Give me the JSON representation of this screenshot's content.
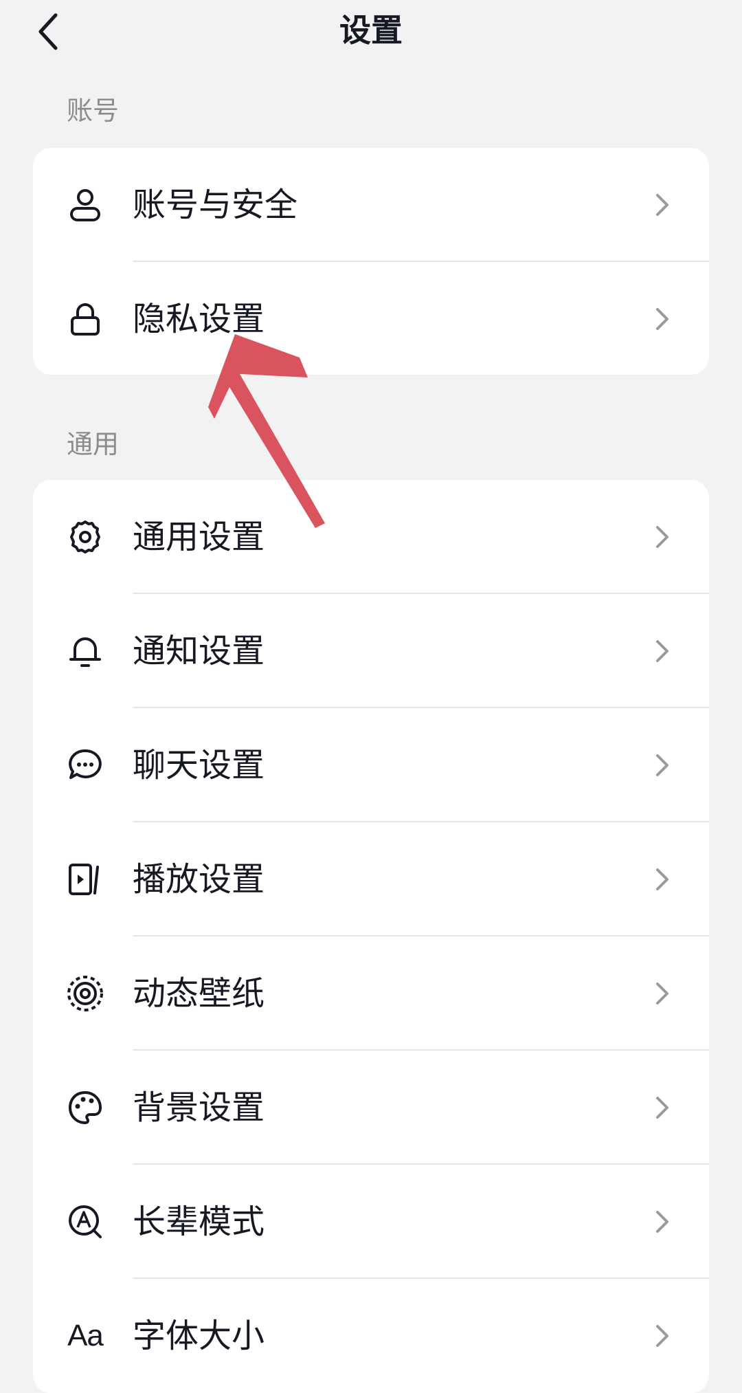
{
  "header": {
    "title": "设置",
    "back_icon": "chevron-left-icon"
  },
  "sections": [
    {
      "label": "账号",
      "items": [
        {
          "label": "账号与安全",
          "icon": "user-icon"
        },
        {
          "label": "隐私设置",
          "icon": "lock-icon"
        }
      ]
    },
    {
      "label": "通用",
      "items": [
        {
          "label": "通用设置",
          "icon": "gear-icon"
        },
        {
          "label": "通知设置",
          "icon": "bell-icon"
        },
        {
          "label": "聊天设置",
          "icon": "chat-bubble-icon"
        },
        {
          "label": "播放设置",
          "icon": "play-icon"
        },
        {
          "label": "动态壁纸",
          "icon": "live-wallpaper-icon"
        },
        {
          "label": "背景设置",
          "icon": "palette-icon"
        },
        {
          "label": "长辈模式",
          "icon": "elder-mode-icon"
        },
        {
          "label": "字体大小",
          "icon": "font-size-icon",
          "icon_text": "Aa"
        }
      ]
    }
  ],
  "annotation": {
    "type": "arrow",
    "color": "#d9545e",
    "points_to": "隐私设置"
  },
  "colors": {
    "background": "#f2f2f2",
    "card": "#ffffff",
    "text": "#161823",
    "secondary_text": "#8c8c8c",
    "chevron": "#9a9a9a"
  }
}
